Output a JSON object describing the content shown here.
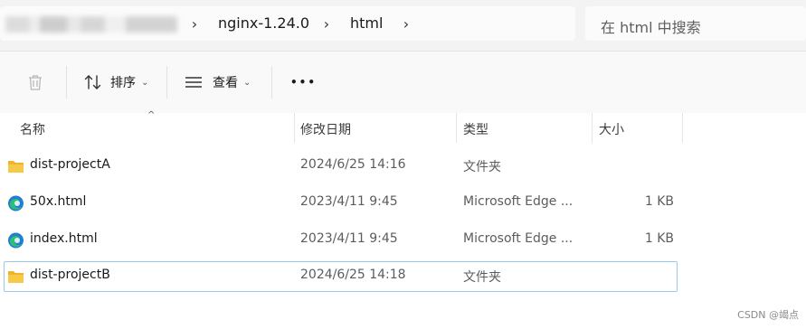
{
  "address_bar": {
    "crumbs": [
      "nginx-1.24.0",
      "html"
    ]
  },
  "search": {
    "placeholder": "在 html 中搜索"
  },
  "toolbar": {
    "sort_label": "排序",
    "view_label": "查看",
    "more_label": "•••"
  },
  "columns": {
    "name": "名称",
    "modified": "修改日期",
    "type": "类型",
    "size": "大小"
  },
  "files": [
    {
      "name": "dist-projectA",
      "modified": "2024/6/25 14:16",
      "type": "文件夹",
      "size": "",
      "icon": "folder-icon"
    },
    {
      "name": "50x.html",
      "modified": "2023/4/11 9:45",
      "type": "Microsoft Edge ...",
      "size": "1 KB",
      "icon": "edge-html-icon"
    },
    {
      "name": "index.html",
      "modified": "2023/4/11 9:45",
      "type": "Microsoft Edge ...",
      "size": "1 KB",
      "icon": "edge-html-icon"
    },
    {
      "name": "dist-projectB",
      "modified": "2024/6/25 14:18",
      "type": "文件夹",
      "size": "",
      "icon": "folder-icon"
    }
  ],
  "colors": {
    "selection_border": "#99c9ef",
    "folder_yellow": "#f7c948",
    "edge_blue": "#1f7fd6",
    "edge_green": "#2fbf71"
  },
  "watermark": "CSDN @竭点"
}
